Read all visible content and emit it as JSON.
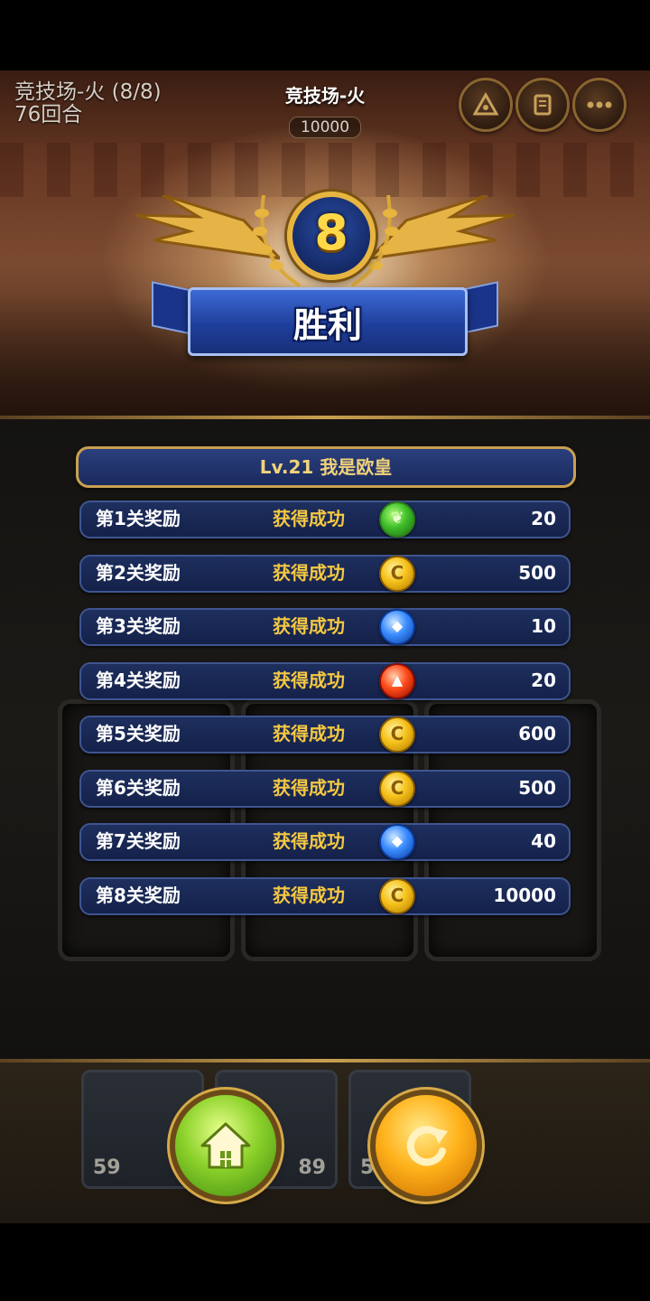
{
  "header": {
    "stage_name": "竞技场-火 (8/8)",
    "rounds": "76回合",
    "title": "竞技场-火",
    "score": "10000"
  },
  "top_buttons": [
    {
      "icon": "triangle-icon"
    },
    {
      "icon": "scroll-icon"
    },
    {
      "icon": "more-icon"
    }
  ],
  "result": {
    "stage_number": "8",
    "victory_text": "胜利"
  },
  "player": {
    "label": "Lv.21  我是欧皇"
  },
  "rewards": [
    {
      "label": "第1关奖励",
      "status": "获得成功",
      "icon": "leaf-orb-icon",
      "value": "20"
    },
    {
      "label": "第2关奖励",
      "status": "获得成功",
      "icon": "gold-coin-icon",
      "value": "500"
    },
    {
      "label": "第3关奖励",
      "status": "获得成功",
      "icon": "water-orb-icon",
      "value": "10"
    },
    {
      "label": "第4关奖励",
      "status": "获得成功",
      "icon": "fire-orb-icon",
      "value": "20"
    },
    {
      "label": "第5关奖励",
      "status": "获得成功",
      "icon": "gold-coin-icon",
      "value": "600"
    },
    {
      "label": "第6关奖励",
      "status": "获得成功",
      "icon": "gold-coin-icon",
      "value": "500"
    },
    {
      "label": "第7关奖励",
      "status": "获得成功",
      "icon": "water-orb-icon",
      "value": "40"
    },
    {
      "label": "第8关奖励",
      "status": "获得成功",
      "icon": "gold-coin-icon",
      "value": "10000"
    }
  ],
  "bottom_cards": [
    {
      "level": "59"
    },
    {
      "level": "89"
    },
    {
      "level": "5"
    }
  ],
  "actions": {
    "home_icon": "home-icon",
    "replay_icon": "replay-icon"
  },
  "colors": {
    "accent_gold": "#c9a050",
    "status_yellow": "#f5c842",
    "panel_blue": "#1a2a5c"
  }
}
